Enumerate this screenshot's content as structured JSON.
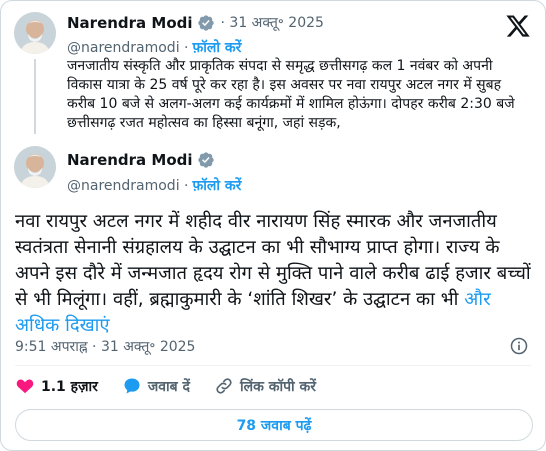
{
  "quoted": {
    "author_name": "Narendra Modi",
    "separator": "·",
    "date": "31 अक्तू॰ 2025",
    "handle": "@narendramodi",
    "follow": "फ़ॉलो करें",
    "text": "जनजातीय संस्कृति और प्राकृतिक संपदा से समृद्ध छत्तीसगढ़ कल 1 नवंबर को अपनी विकास यात्रा के 25 वर्ष पूरे कर रहा है। इस अवसर पर नवा रायपुर अटल नगर में सुबह करीब 10 बजे से अलग-अलग कई कार्यक्रमों में शामिल होऊंगा। दोपहर करीब 2:30 बजे छत्तीसगढ़ रजत महोत्सव का हिस्सा बनूंगा, जहां सड़क,"
  },
  "main": {
    "author_name": "Narendra Modi",
    "handle": "@narendramodi",
    "follow": "फ़ॉलो करें",
    "text": "नवा रायपुर अटल नगर में शहीद वीर नारायण सिंह स्मारक और जनजातीय स्वतंत्रता सेनानी संग्रहालय के उद्घाटन का भी सौभाग्य प्राप्त होगा। राज्य के अपने इस दौरे में जन्मजात हृदय रोग से मुक्ति पाने वाले करीब ढाई हजार बच्चों से भी मिलूंगा। वहीं, ब्रह्माकुमारी के ‘शांति शिखर’ के उद्घाटन का भी",
    "show_more": "और अधिक दिखाएं",
    "time": "9:51 अपराह्न",
    "date": "31 अक्तू॰ 2025"
  },
  "actions": {
    "likes": "1.1 हज़ार",
    "reply": "जवाब दें",
    "copy_link": "लिंक कॉपी करें"
  },
  "replies_button": "78 जवाब पढ़ें",
  "colors": {
    "accent": "#1d9bf0",
    "like_red": "#f91880",
    "muted": "#536471",
    "verified": "#829aab"
  }
}
